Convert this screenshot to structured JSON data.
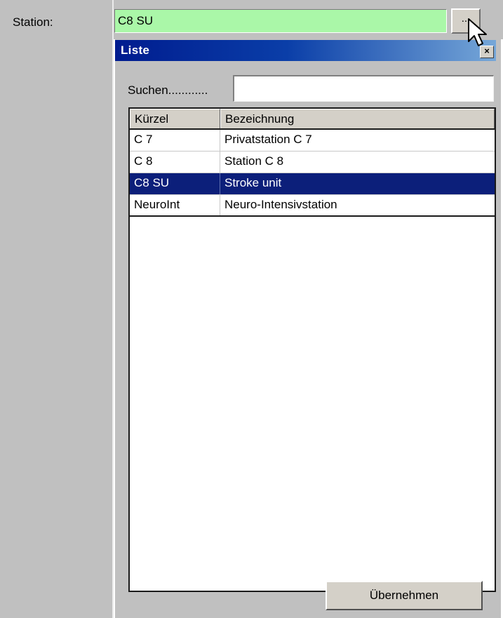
{
  "station": {
    "label": "Station:",
    "value": "C8 SU",
    "browse_label": "..."
  },
  "popup": {
    "title": "Liste",
    "close_glyph": "×",
    "search_label": "Suchen............",
    "search_value": "",
    "columns": [
      "Kürzel",
      "Bezeichnung"
    ],
    "rows": [
      {
        "code": "C 7",
        "name": "Privatstation C 7"
      },
      {
        "code": "C 8",
        "name": "Station C 8"
      },
      {
        "code": "C8 SU",
        "name": "Stroke unit"
      },
      {
        "code": "NeuroInt",
        "name": "Neuro-Intensivstation"
      }
    ],
    "selected_index": 2,
    "apply_label": "Übernehmen"
  },
  "colors": {
    "field_bg": "#aaf7a8",
    "selection_bg": "#0c1f7a",
    "titlebar_start": "#001c8f"
  }
}
